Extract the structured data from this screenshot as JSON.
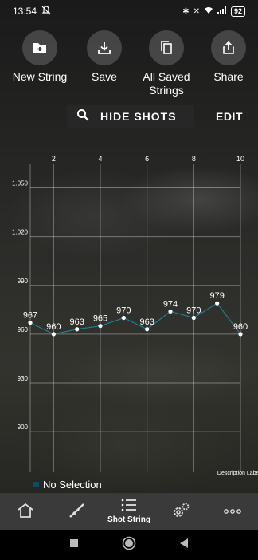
{
  "status": {
    "time": "13:54",
    "battery": "92"
  },
  "actions": [
    {
      "id": "new-string",
      "label": "New String",
      "icon": "add-folder-icon"
    },
    {
      "id": "save",
      "label": "Save",
      "icon": "download-icon"
    },
    {
      "id": "all-saved",
      "label": "All Saved\nStrings",
      "icon": "copy-icon"
    },
    {
      "id": "share",
      "label": "Share",
      "icon": "share-icon"
    }
  ],
  "toolbar": {
    "hide_shots": "HIDE SHOTS",
    "edit": "EDIT"
  },
  "chart_data": {
    "type": "line",
    "x": [
      1,
      2,
      3,
      4,
      5,
      6,
      7,
      8,
      9,
      10
    ],
    "series": [
      {
        "values": [
          967,
          960,
          963,
          965,
          970,
          963,
          974,
          970,
          979,
          960
        ],
        "color": "#1e7f8f"
      }
    ],
    "x_ticks": [
      2,
      4,
      6,
      8,
      10
    ],
    "x_axis_position": "top",
    "y_ticks": [
      "1.050",
      "1.020",
      "990",
      "960",
      "930",
      "900"
    ],
    "y_tick_values": [
      1050,
      1020,
      990,
      960,
      930,
      900
    ],
    "xlim": [
      1,
      10
    ],
    "ylim": [
      875,
      1065
    ],
    "grid": true,
    "description_label": "Description Label"
  },
  "legend": {
    "label": "No Selection",
    "color": "#0d4f5c"
  },
  "nav": [
    {
      "id": "home",
      "label": "",
      "icon": "home-icon"
    },
    {
      "id": "rifle",
      "label": "",
      "icon": "rifle-icon"
    },
    {
      "id": "shot-string",
      "label": "Shot String",
      "icon": "list-icon"
    },
    {
      "id": "settings",
      "label": "",
      "icon": "gears-icon"
    },
    {
      "id": "more",
      "label": "",
      "icon": "more-icon"
    }
  ]
}
